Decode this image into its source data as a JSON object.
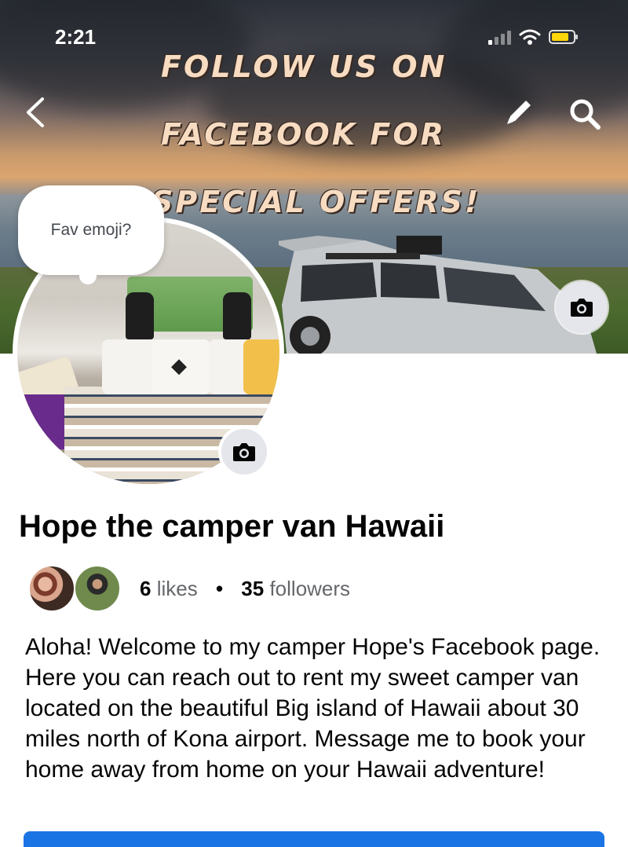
{
  "status_bar": {
    "time": "2:21"
  },
  "cover": {
    "overlay_lines": [
      "Follow us on",
      "Facebook for",
      "special offers!"
    ]
  },
  "profile": {
    "bubble_text": "Fav emoji?",
    "page_name": "Hope the camper van Hawaii",
    "likes_count": "6",
    "likes_label": "likes",
    "followers_count": "35",
    "followers_label": "followers",
    "about": "Aloha! Welcome to my camper Hope's Facebook page. Here you can reach out to rent my sweet camper van located on the beautiful Big island of Hawaii about 30 miles north of Kona airport. Message me to book your home away from home on your Hawaii adventure!"
  },
  "icons": {
    "back": "chevron-left-icon",
    "edit": "pencil-icon",
    "search": "search-icon",
    "camera": "camera-icon"
  },
  "colors": {
    "accent": "#1b74e4",
    "secondary_text": "#65676b",
    "button_bg": "#e4e6eb",
    "overlay_text": "#f7dcc2"
  }
}
